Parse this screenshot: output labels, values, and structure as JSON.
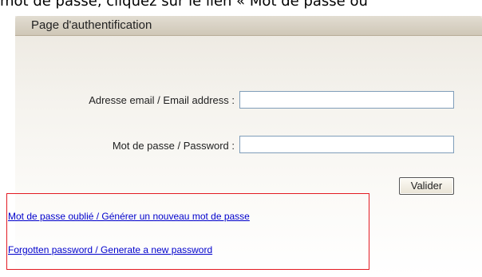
{
  "top_text": "mot de passe, cliquez sur le lien « Mot de passe ou",
  "panel": {
    "title": "Page d'authentification"
  },
  "form": {
    "email_label": "Adresse email / Email address :",
    "email_value": "",
    "password_label": "Mot de passe / Password :",
    "password_value": "",
    "submit_label": "Valider"
  },
  "links": {
    "forgot_fr": "Mot de passe oublié / Générer un nouveau mot de passe",
    "forgot_en": "Forgotten password / Generate a new password"
  },
  "colors": {
    "highlight_box": "#e31b23",
    "link": "#0000cc"
  }
}
